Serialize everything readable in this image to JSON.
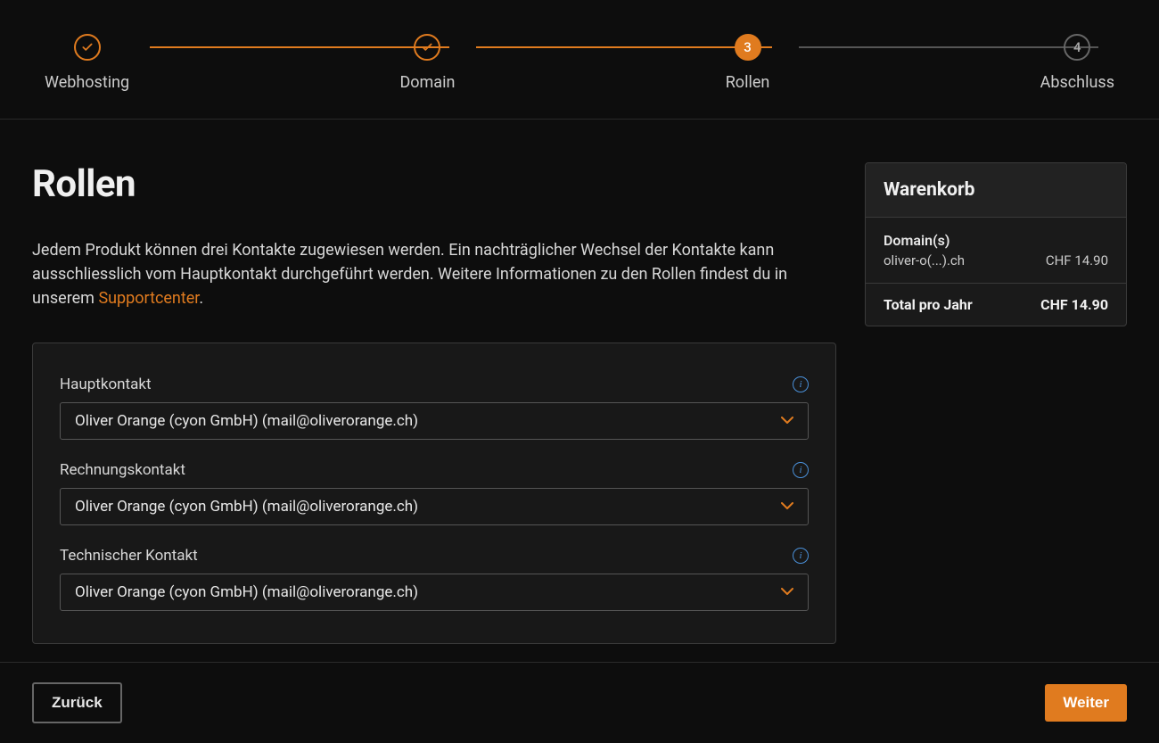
{
  "stepper": {
    "steps": [
      {
        "label": "Webhosting",
        "state": "done"
      },
      {
        "label": "Domain",
        "state": "done"
      },
      {
        "label": "Rollen",
        "state": "active",
        "number": "3"
      },
      {
        "label": "Abschluss",
        "state": "pending",
        "number": "4"
      }
    ]
  },
  "page": {
    "title": "Rollen",
    "intro_pre": "Jedem Produkt können drei Kontakte zugewiesen werden. Ein nachträglicher Wechsel der Kontakte kann ausschliesslich vom Hauptkontakt durchgeführt werden. Weitere Informationen zu den Rollen findest du in unserem ",
    "intro_link": "Supportcenter",
    "intro_post": "."
  },
  "form": {
    "primary": {
      "label": "Hauptkontakt",
      "value": "Oliver Orange (cyon GmbH) (mail@oliverorange.ch)"
    },
    "billing": {
      "label": "Rechnungskontakt",
      "value": "Oliver Orange (cyon GmbH) (mail@oliverorange.ch)"
    },
    "technical": {
      "label": "Technischer Kontakt",
      "value": "Oliver Orange (cyon GmbH) (mail@oliverorange.ch)"
    }
  },
  "cart": {
    "title": "Warenkorb",
    "domains_heading": "Domain(s)",
    "domain_name": "oliver-o(...).ch",
    "domain_price": "CHF 14.90",
    "total_label": "Total pro Jahr",
    "total_value": "CHF 14.90"
  },
  "footer": {
    "back": "Zurück",
    "next": "Weiter"
  }
}
